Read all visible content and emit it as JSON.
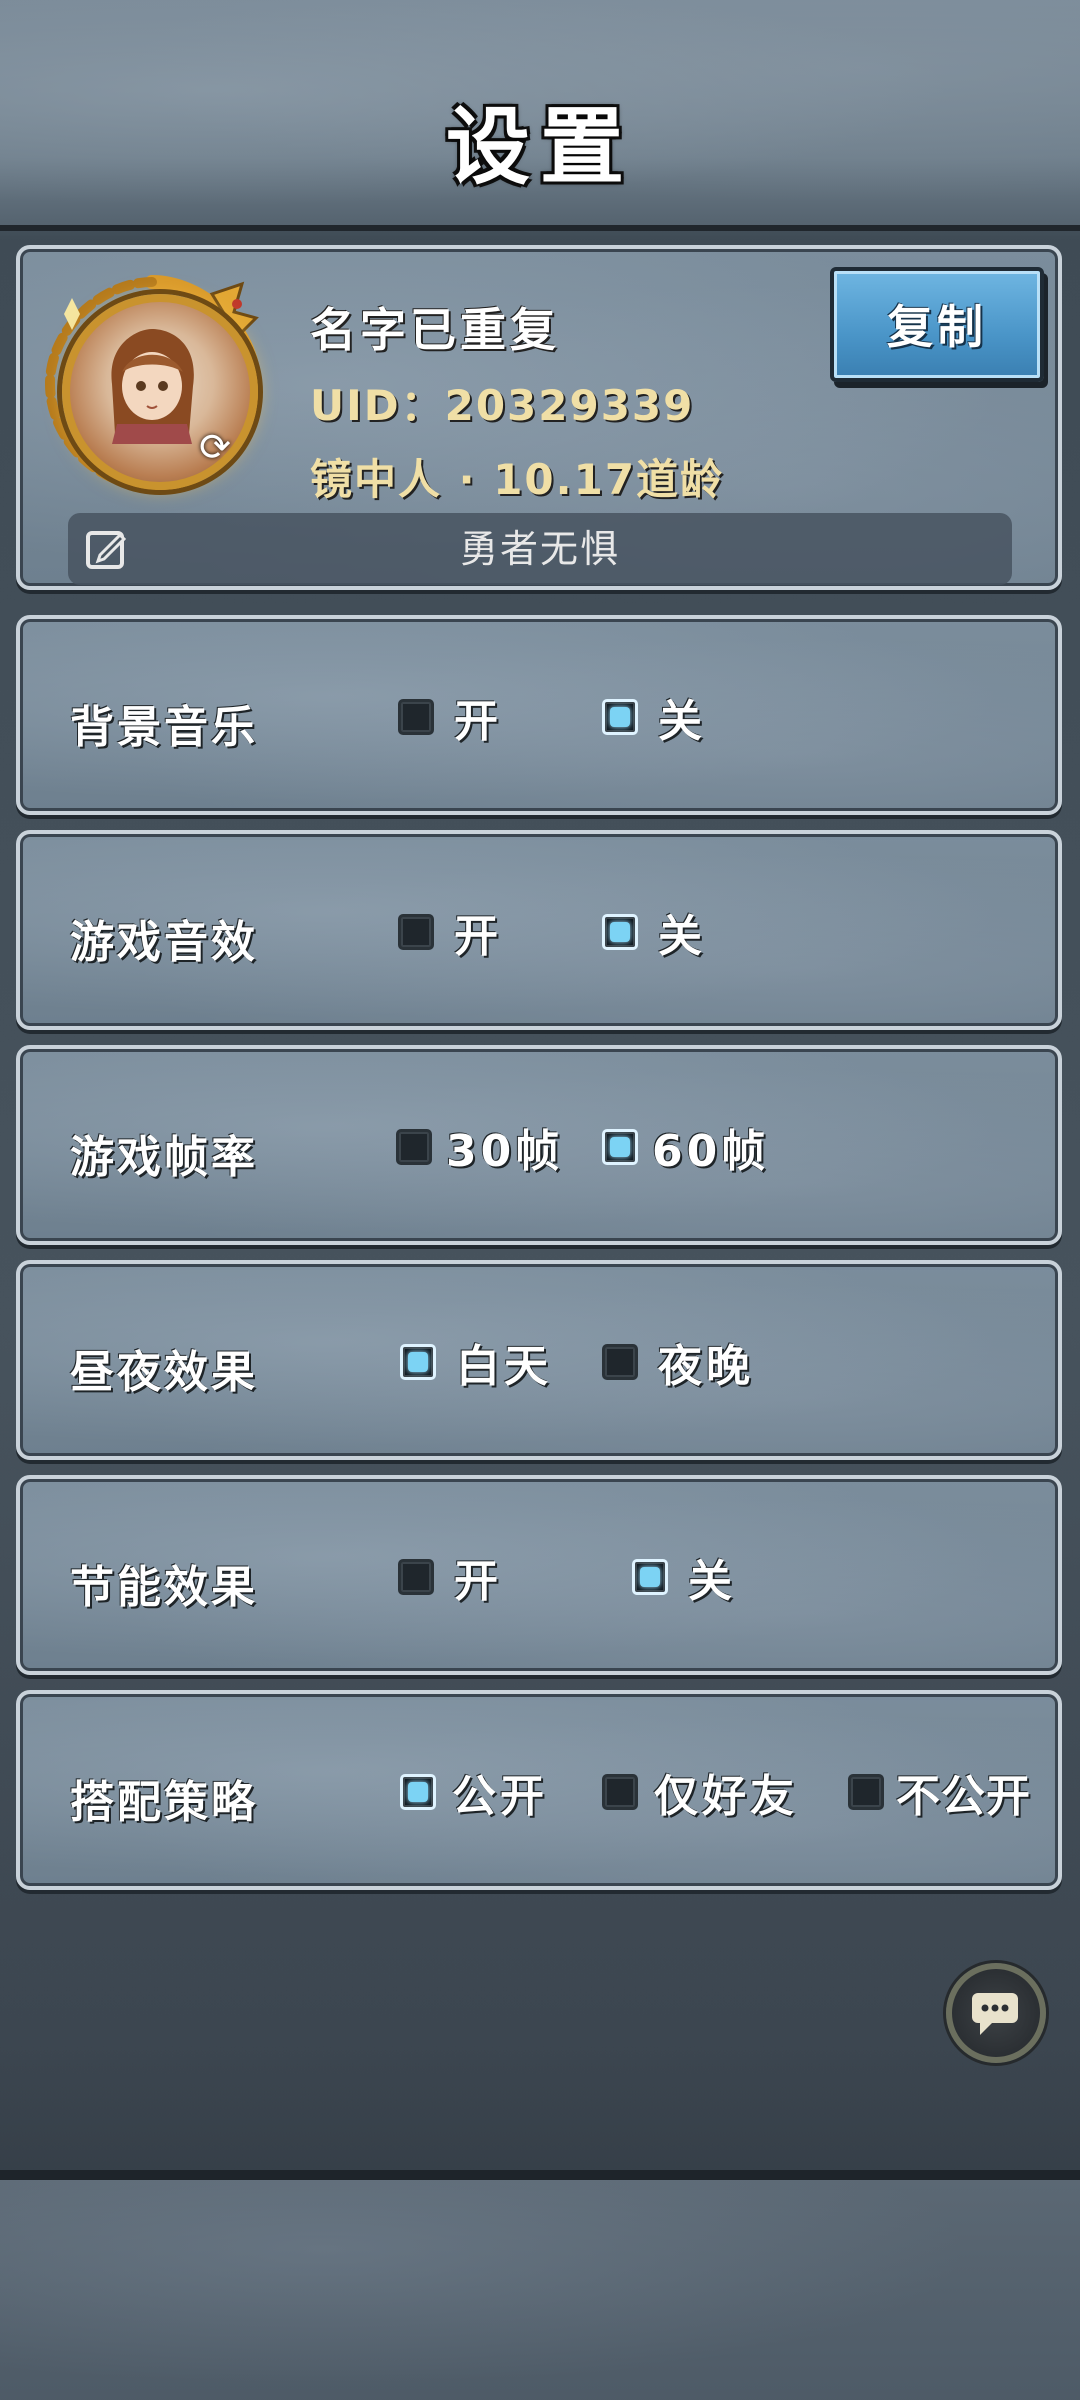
{
  "header": {
    "title": "设置"
  },
  "profile": {
    "name": "名字已重复",
    "uid": "UID：20329339",
    "rank": "镜中人 · 10.17道龄",
    "copy_label": "复制",
    "signature": "勇者无惧"
  },
  "settings": [
    {
      "label": "背景音乐",
      "options": [
        {
          "label": "开",
          "checked": false
        },
        {
          "label": "关",
          "checked": true
        }
      ]
    },
    {
      "label": "游戏音效",
      "options": [
        {
          "label": "开",
          "checked": false
        },
        {
          "label": "关",
          "checked": true
        }
      ]
    },
    {
      "label": "游戏帧率",
      "options": [
        {
          "label": "30帧",
          "checked": false
        },
        {
          "label": "60帧",
          "checked": true
        }
      ]
    },
    {
      "label": "昼夜效果",
      "options": [
        {
          "label": "白天",
          "checked": true
        },
        {
          "label": "夜晚",
          "checked": false
        }
      ]
    },
    {
      "label": "节能效果",
      "options": [
        {
          "label": "开",
          "checked": false
        },
        {
          "label": "关",
          "checked": true
        }
      ]
    },
    {
      "label": "搭配策略",
      "options": [
        {
          "label": "公开",
          "checked": true
        },
        {
          "label": "仅好友",
          "checked": false
        },
        {
          "label": "不公开",
          "checked": false
        }
      ]
    }
  ],
  "icons": {
    "refresh": "refresh-icon",
    "edit": "edit-icon",
    "chat": "chat-bubble-icon"
  },
  "colors": {
    "accent_blue": "#4a95c8",
    "checkbox_on": "#7cd3f4",
    "gold_text": "#f0dfa6"
  }
}
